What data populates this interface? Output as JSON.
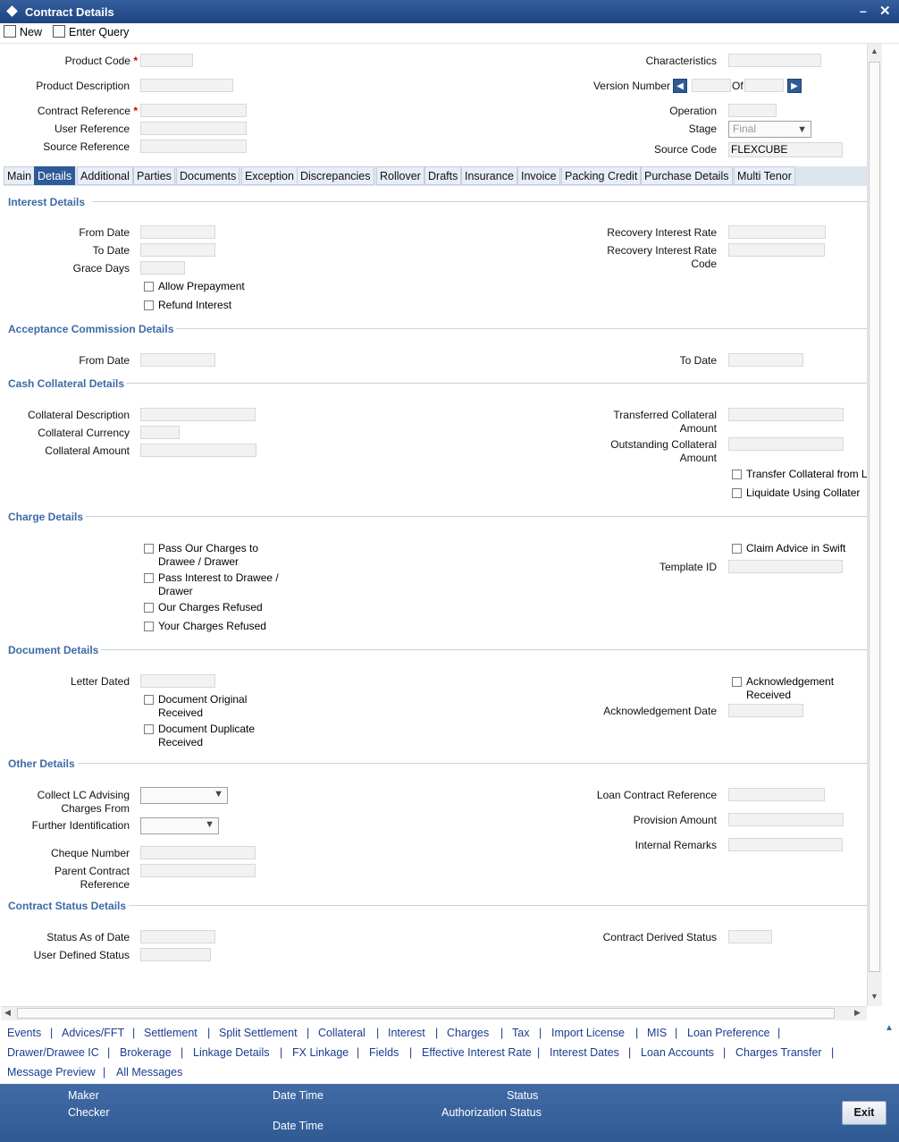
{
  "window": {
    "title": "Contract Details"
  },
  "toolbar": {
    "new_label": "New",
    "enter_query_label": "Enter Query"
  },
  "header": {
    "product_code_label": "Product Code",
    "product_description_label": "Product Description",
    "contract_reference_label": "Contract Reference",
    "user_reference_label": "User Reference",
    "source_reference_label": "Source Reference",
    "characteristics_label": "Characteristics",
    "version_number_label": "Version Number",
    "of_label": "Of",
    "operation_label": "Operation",
    "stage_label": "Stage",
    "stage_value": "Final",
    "source_code_label": "Source Code",
    "source_code_value": "FLEXCUBE",
    "required_mark": "*"
  },
  "tabs": [
    "Main",
    "Details",
    "Additional",
    "Parties",
    "Documents",
    "Exception",
    "Discrepancies",
    "Rollover",
    "Drafts",
    "Insurance",
    "Invoice",
    "Packing Credit",
    "Purchase Details",
    "Multi Tenor"
  ],
  "interest": {
    "section": "Interest Details",
    "from_date": "From Date",
    "to_date": "To Date",
    "grace_days": "Grace Days",
    "allow_prepayment": "Allow Prepayment",
    "refund_interest": "Refund Interest",
    "recovery_rate": "Recovery Interest Rate",
    "recovery_rate_code_1": "Recovery Interest Rate",
    "recovery_rate_code_2": "Code"
  },
  "acceptance": {
    "section": "Acceptance Commission Details",
    "from_date": "From Date",
    "to_date": "To Date"
  },
  "collateral": {
    "section": "Cash Collateral Details",
    "description": "Collateral Description",
    "currency": "Collateral Currency",
    "amount": "Collateral Amount",
    "transferred_1": "Transferred Collateral",
    "transferred_2": "Amount",
    "outstanding_1": "Outstanding Collateral",
    "outstanding_2": "Amount",
    "transfer_from": "Transfer Collateral from L",
    "liquidate_using": "Liquidate Using Collater"
  },
  "charges": {
    "section": "Charge Details",
    "pass_our_1": "Pass Our Charges to",
    "pass_our_2": "Drawee / Drawer",
    "pass_interest_1": "Pass Interest to Drawee /",
    "pass_interest_2": "Drawer",
    "our_refused": "Our Charges Refused",
    "your_refused": "Your Charges Refused",
    "claim_advice": "Claim Advice in Swift",
    "template_id": "Template ID"
  },
  "documents": {
    "section": "Document Details",
    "letter_dated": "Letter Dated",
    "original_1": "Document Original",
    "original_2": "Received",
    "duplicate_1": "Document Duplicate",
    "duplicate_2": "Received",
    "ack_1": "Acknowledgement",
    "ack_2": "Received",
    "ack_date": "Acknowledgement Date"
  },
  "other": {
    "section": "Other Details",
    "collect_1": "Collect LC Advising",
    "collect_2": "Charges From",
    "further_id": "Further Identification",
    "cheque": "Cheque Number",
    "parent_1": "Parent Contract",
    "parent_2": "Reference",
    "loan_ref": "Loan Contract Reference",
    "provision": "Provision Amount",
    "remarks": "Internal Remarks"
  },
  "status": {
    "section": "Contract Status Details",
    "as_of_date": "Status As of Date",
    "user_defined": "User Defined Status",
    "derived": "Contract Derived Status"
  },
  "links_row1": [
    "Events",
    "Advices/FFT",
    "Settlement",
    "Split Settlement",
    "Collateral",
    "Interest",
    "Charges",
    "Tax",
    "Import License",
    "MIS",
    "Loan Preference"
  ],
  "links_row2": [
    "Drawer/Drawee IC",
    "Brokerage",
    "Linkage Details",
    "FX Linkage",
    "Fields",
    "Effective Interest Rate",
    "Interest Dates",
    "Loan Accounts",
    "Charges Transfer"
  ],
  "links_row3": [
    "Message Preview",
    "All Messages"
  ],
  "link_separator": "|",
  "footer": {
    "maker": "Maker",
    "checker": "Checker",
    "date_time": "Date Time",
    "status": "Status",
    "auth_status": "Authorization Status",
    "exit": "Exit"
  }
}
